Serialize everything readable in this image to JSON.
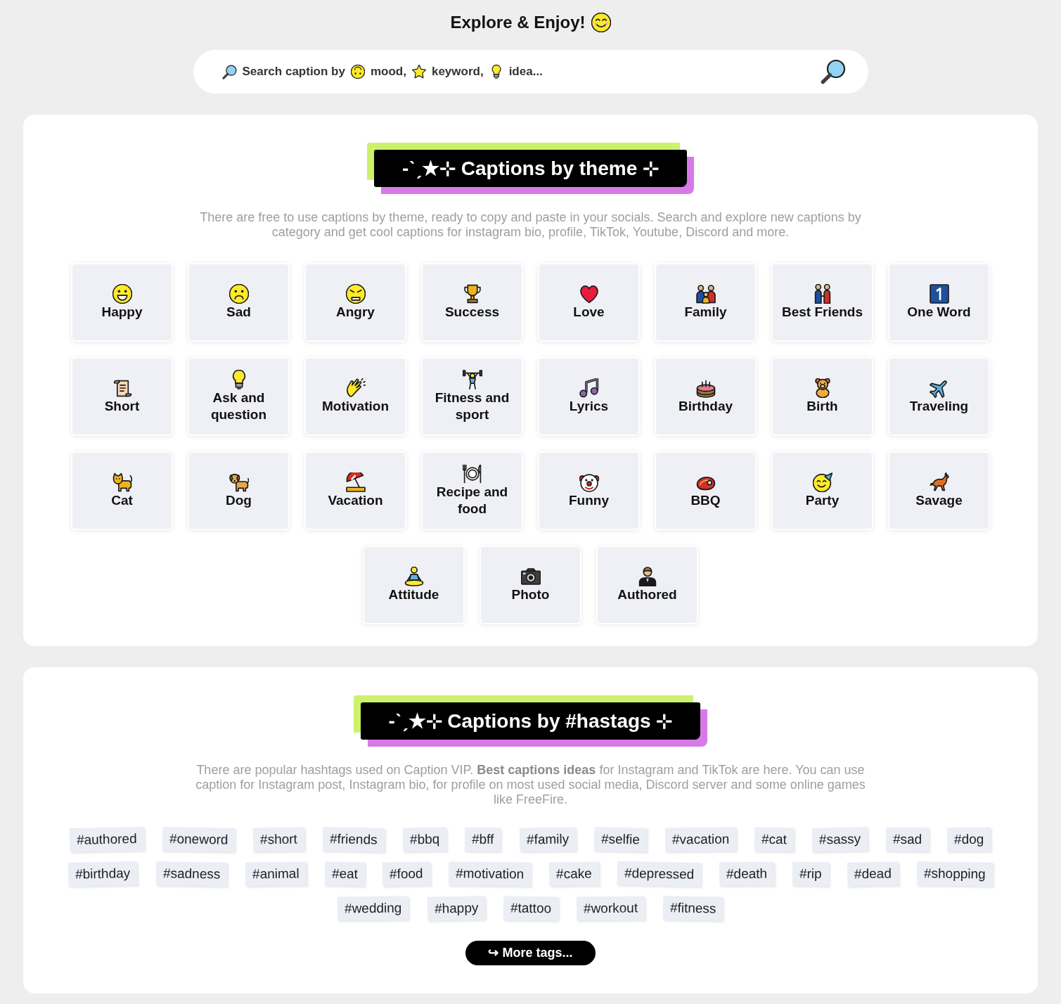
{
  "header": {
    "title": "Explore & Enjoy!"
  },
  "search": {
    "placeholder": [
      "Search caption by",
      "mood,",
      "keyword,",
      "idea..."
    ]
  },
  "themes": {
    "title": "-ˋˏ★⊹ Captions by theme ⊹",
    "description": "There are free to use captions by theme, ready to copy and paste in your socials. Search and explore new captions by category and get cool captions for instagram bio, profile, TikTok, Youtube, Discord and more.",
    "categories": [
      "Happy",
      "Sad",
      "Angry",
      "Success",
      "Love",
      "Family",
      "Best Friends",
      "One Word",
      "Short",
      "Ask and question",
      "Motivation",
      "Fitness and sport",
      "Lyrics",
      "Birthday",
      "Birth",
      "Traveling",
      "Cat",
      "Dog",
      "Vacation",
      "Recipe and food",
      "Funny",
      "BBQ",
      "Party",
      "Savage",
      "Attitude",
      "Photo",
      "Authored"
    ]
  },
  "hashtags": {
    "title": "-ˋˏ★⊹ Captions by #hastags ⊹",
    "description": "There are popular hashtags used on Caption VIP. **Best captions ideas** for Instagram and TikTok are here. You can use caption for Instagram post, Instagram bio, for profile on most used social media, Discord server and some online games like FreeFire.",
    "tag_rows": [
      [
        "#authored",
        "#oneword",
        "#short",
        "#friends",
        "#bbq",
        "#bff",
        "#family",
        "#selfie",
        "#vacation",
        "#cat",
        "#sassy",
        "#sad",
        "#dog"
      ],
      [
        "#birthday",
        "#sadness",
        "#animal",
        "#eat",
        "#food",
        "#motivation",
        "#cake",
        "#depressed",
        "#death",
        "#rip",
        "#dead",
        "#shopping"
      ],
      [
        "#wedding",
        "#happy",
        "#tattoo",
        "#workout",
        "#fitness"
      ]
    ],
    "more_button": "↪ More tags..."
  }
}
